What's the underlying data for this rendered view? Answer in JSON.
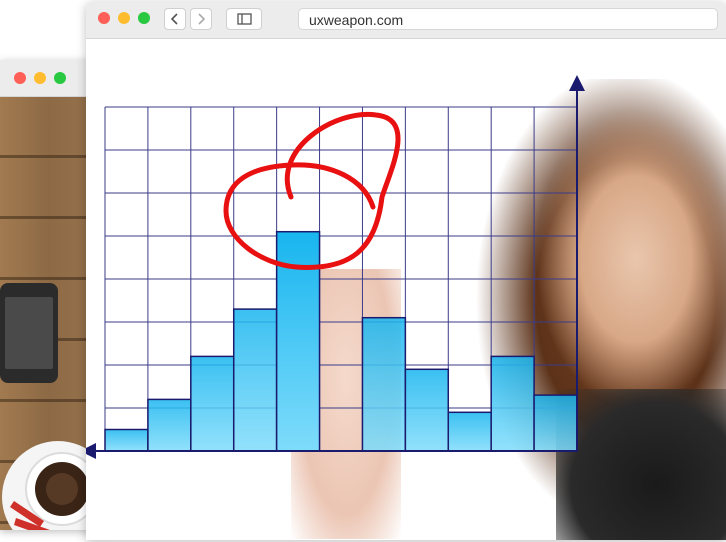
{
  "browser": {
    "url": "uxweapon.com"
  },
  "icons": {
    "back": "chevron-left-icon",
    "forward": "chevron-right-icon",
    "sidebar": "sidebar-icon"
  },
  "colors": {
    "traffic_red": "#fe5f57",
    "traffic_yellow": "#febc2e",
    "traffic_green": "#28c840",
    "bar_fill": "#1ab8f0",
    "grid_line": "#3b3b8a",
    "circle_marker": "#e81010"
  },
  "chart_data": {
    "type": "bar",
    "values": [
      0.5,
      1.2,
      2.2,
      3.3,
      5.1,
      0.0,
      3.1,
      1.9,
      0.9,
      2.2,
      1.3
    ],
    "ylim": [
      0,
      8
    ],
    "grid": true,
    "highlighted_index": 4
  }
}
